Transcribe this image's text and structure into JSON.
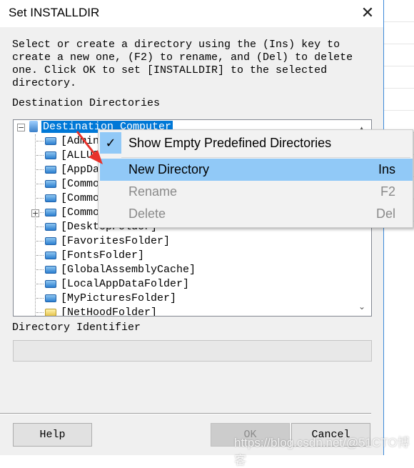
{
  "dialog": {
    "title": "Set INSTALLDIR",
    "close_icon": "close-icon",
    "description": "Select or create a directory using the (Ins) key to\ncreate a new one, (F2) to rename, and (Del) to delete\none. Click OK to set [INSTALLDIR] to the selected\ndirectory.",
    "tree_label": "Destination Directories",
    "tree": {
      "root": "Destination Computer",
      "items": [
        "[Admin",
        "[ALLUS",
        "[AppDa",
        "[Commo",
        "[Commo",
        "[Commo",
        "[DesktopFolder]",
        "[FavoritesFolder]",
        "[FontsFolder]",
        "[GlobalAssemblyCache]",
        "[LocalAppDataFolder]",
        "[MyPicturesFolder]",
        "[NetHoodFolder]"
      ]
    },
    "identifier_label": "Directory Identifier",
    "identifier_value": "",
    "buttons": {
      "help": "Help",
      "ok": "OK",
      "cancel": "Cancel"
    }
  },
  "context_menu": {
    "items": [
      {
        "label": "Show Empty Predefined Directories",
        "checked": true,
        "shortcut": ""
      },
      {
        "label": "New Directory",
        "shortcut": "Ins",
        "highlighted": true
      },
      {
        "label": "Rename",
        "shortcut": "F2",
        "disabled": true
      },
      {
        "label": "Delete",
        "shortcut": "Del",
        "disabled": true
      }
    ]
  },
  "watermark": "https://blog.csdn.net/@51CTO博客",
  "colors": {
    "selection": "#0078d7",
    "menu_highlight": "#91c9f7",
    "arrow": "#e8322b"
  }
}
